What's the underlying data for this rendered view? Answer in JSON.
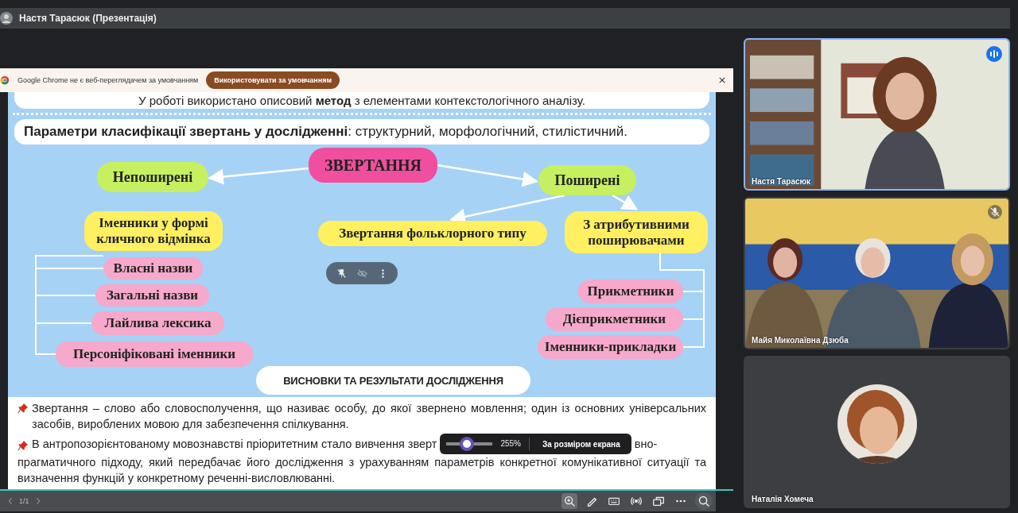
{
  "title_bar": {
    "title": "Настя Тарасюк (Презентація)"
  },
  "browser_banner": {
    "message": "Google Chrome не є веб-переглядачем за умовчанням",
    "button": "Використовувати за умовчанням"
  },
  "slide": {
    "intro": "У роботі використано описовий **метод** з елементами контекстологічного аналізу.",
    "parameters": "**Параметри класифікації звертань у дослідженні**: структурний, морфологічний, стилістичний.",
    "nodes": [
      {
        "kind": "root",
        "text": "ЗВЕРТАННЯ"
      },
      {
        "kind": "category",
        "text": "Непоширені"
      },
      {
        "kind": "category",
        "text": "Поширені"
      },
      {
        "kind": "subtype",
        "text": "Іменники у формі кличного відмінка"
      },
      {
        "kind": "subtype",
        "text": "Звертання фольклорного типу"
      },
      {
        "kind": "subtype",
        "text": "З атрибутивними поширювачами"
      },
      {
        "kind": "item",
        "text": "Власні назви"
      },
      {
        "kind": "item",
        "text": "Загальні назви"
      },
      {
        "kind": "item",
        "text": "Лайлива лексика"
      },
      {
        "kind": "item",
        "text": "Персоніфіковані іменники"
      },
      {
        "kind": "item",
        "text": "Прикметники"
      },
      {
        "kind": "item",
        "text": "Дієприкметники"
      },
      {
        "kind": "item",
        "text": "Іменники-прикладки"
      }
    ],
    "conclusions_heading": "ВИСНОВКИ ТА РЕЗУЛЬТАТИ ДОСЛІДЖЕННЯ",
    "paragraph_1": "Звертання – слово або словосполучення, що називає особу, до якої звернено мовлення; один із основних універсальних засобів, вироблених мовою для забезпечення спілкування.",
    "paragraph_2_start": "В антропозорієнтованому мовознавстві пріоритетним стало вивчення зверт",
    "paragraph_2_after_popup": "вно-",
    "paragraph_2_rest": "прагматичного підходу, який передбачає його дослідження з урахуванням параметрів конкретної комунікативної ситуації та визначення функцій у конкретному реченні-висловлюванні."
  },
  "zoom_popup": {
    "level": 0.42,
    "percent": "255%",
    "fit_button": "За розміром екрана"
  },
  "viewer_toolbar": {
    "page": "1/1",
    "tools": [
      {
        "kind": "zoom",
        "selected": true
      },
      {
        "kind": "pen",
        "selected": false
      },
      {
        "kind": "keyboard",
        "selected": false
      },
      {
        "kind": "broadcast",
        "selected": false
      },
      {
        "kind": "screens",
        "selected": false
      },
      {
        "kind": "more",
        "selected": false
      }
    ]
  },
  "participants": [
    {
      "name": "Настя Тарасюк",
      "kind": "video",
      "speaking": true,
      "muted": false
    },
    {
      "name": "Майя Миколаївна Дзюба",
      "kind": "video",
      "speaking": false,
      "muted": true
    },
    {
      "name": "Наталія Хомеча",
      "kind": "avatar",
      "speaking": false,
      "muted": false
    }
  ]
}
